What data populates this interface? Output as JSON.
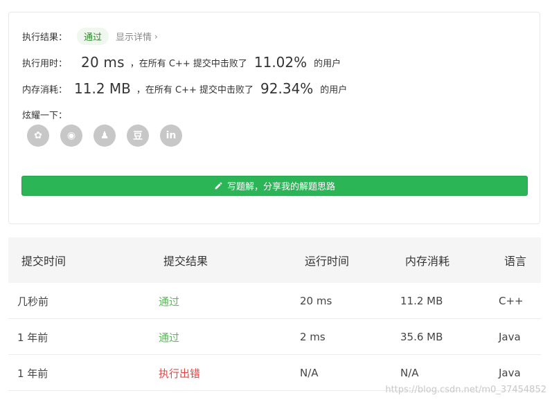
{
  "result": {
    "label": "执行结果：",
    "status": "通过",
    "detail_link": "显示详情",
    "chevron": "›"
  },
  "runtime": {
    "label": "执行用时：",
    "value": "20 ms",
    "prefix": "，在所有 C++ 提交中击败了",
    "percent": "11.02%",
    "suffix": "的用户"
  },
  "memory": {
    "label": "内存消耗：",
    "value": "11.2 MB",
    "prefix": "，在所有 C++ 提交中击败了",
    "percent": "92.34%",
    "suffix": "的用户"
  },
  "share": {
    "label": "炫耀一下：",
    "buttons": [
      {
        "icon": "wechat-icon",
        "glyph": "✿"
      },
      {
        "icon": "weibo-icon",
        "glyph": "◉"
      },
      {
        "icon": "qq-icon",
        "glyph": "♟"
      },
      {
        "icon": "douban-icon",
        "glyph": "豆"
      },
      {
        "icon": "linkedin-icon",
        "glyph": "in"
      }
    ]
  },
  "write_solution": {
    "label": "写题解，分享我的解题思路",
    "icon": "pencil-icon"
  },
  "table": {
    "headers": [
      "提交时间",
      "提交结果",
      "运行时间",
      "内存消耗",
      "语言"
    ],
    "rows": [
      {
        "time": "几秒前",
        "result": "通过",
        "result_type": "ok",
        "runtime": "20 ms",
        "memory": "11.2 MB",
        "lang": "C++"
      },
      {
        "time": "1 年前",
        "result": "通过",
        "result_type": "ok",
        "runtime": "2 ms",
        "memory": "35.6 MB",
        "lang": "Java"
      },
      {
        "time": "1 年前",
        "result": "执行出错",
        "result_type": "err",
        "runtime": "N/A",
        "memory": "N/A",
        "lang": "Java"
      }
    ]
  },
  "watermark": "https://blog.csdn.net/m0_37454852",
  "colors": {
    "accent_green": "#2bb557",
    "pass_green": "#5cb85c",
    "error_red": "#e54545",
    "share_gray": "#c7c7c7"
  }
}
